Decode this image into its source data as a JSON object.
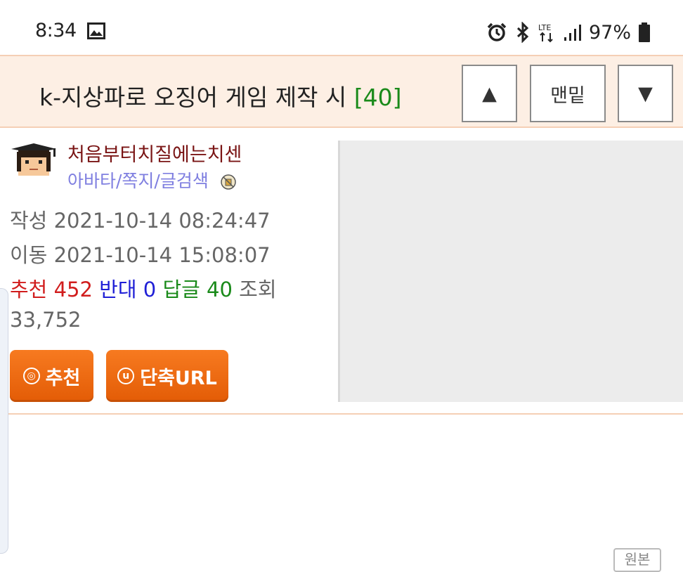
{
  "status_bar": {
    "time": "8:34",
    "battery": "97%",
    "icons": [
      "image-icon",
      "alarm-icon",
      "bluetooth-icon",
      "lte-icon",
      "signal-icon",
      "battery-icon"
    ]
  },
  "post": {
    "title": "k-지상파로 오징어 게임 제작 시",
    "comment_count_label": "[40]"
  },
  "nav": {
    "up_symbol": "▲",
    "bottom_label": "맨밑",
    "down_symbol": "▼"
  },
  "author": {
    "nickname": "처음부터치질에는치센",
    "links": "아바타/쪽지/글검색"
  },
  "meta": {
    "created_label": "작성",
    "created": "2021-10-14 08:24:47",
    "moved_label": "이동",
    "moved": "2021-10-14 15:08:07",
    "recommend_label": "추천",
    "recommend": "452",
    "oppose_label": "반대",
    "oppose": "0",
    "reply_label": "답글",
    "reply": "40",
    "views_label": "조회",
    "views": "33,752"
  },
  "actions": {
    "recommend_label": "추천",
    "recommend_icon_char": "◎",
    "short_url_label": "단축URL",
    "short_url_icon_char": "u"
  },
  "bottom": {
    "button_label": "원본"
  },
  "colors": {
    "title_bar_bg": "#fdefe4",
    "accent_orange": "#f06a12",
    "nickname": "#7a1515",
    "link": "#7f7fe0",
    "recommend": "#d11d1d",
    "oppose": "#1f1fd6",
    "reply": "#1a8a1a"
  }
}
